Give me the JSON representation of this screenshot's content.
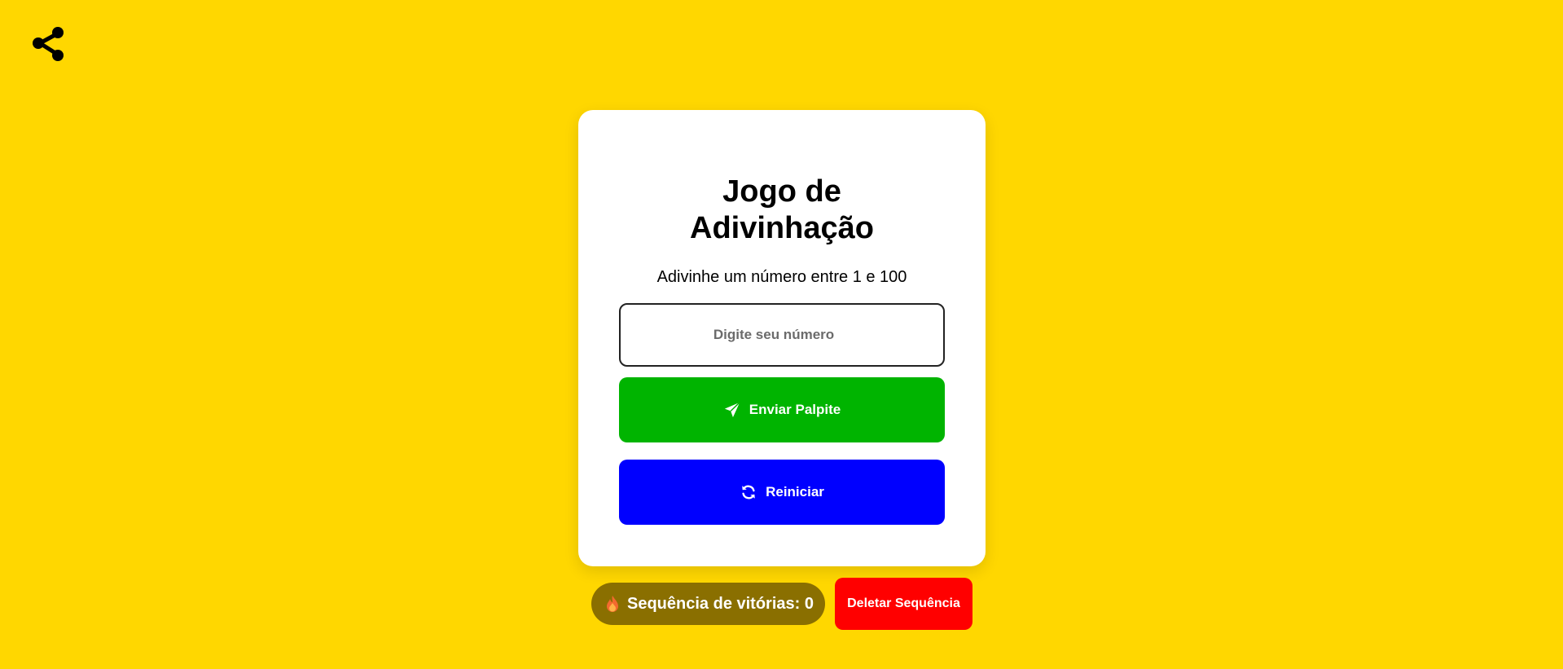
{
  "header": {
    "share_icon": "share-icon"
  },
  "game": {
    "title_line1": "Jogo de",
    "title_line2": "Adivinhação",
    "subtitle": "Adivinhe um número entre 1 e 100",
    "input": {
      "placeholder": "Digite seu número",
      "value": ""
    },
    "send_button": {
      "label": "Enviar Palpite",
      "icon": "paper-plane-icon",
      "color": "#00B400"
    },
    "restart_button": {
      "label": "Reiniciar",
      "icon": "refresh-icon",
      "color": "#0000FF"
    }
  },
  "footer": {
    "streak": {
      "icon": "flame-icon",
      "label": "Sequência de vitórias: 0"
    },
    "delete_button": {
      "label": "Deletar Sequência",
      "color": "#FF0000"
    }
  },
  "colors": {
    "background": "#FFD700",
    "card": "#FFFFFF",
    "streak_badge": "#8A6F00"
  }
}
